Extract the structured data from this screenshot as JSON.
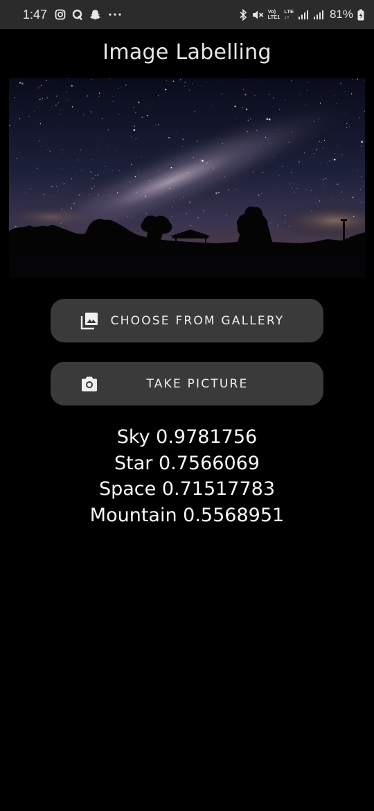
{
  "status_bar": {
    "time": "1:47",
    "volte_top": "Vo)",
    "volte_bottom": "LTE1",
    "lte_top": "LTE",
    "lte_bottom": "↓↑",
    "battery": "81%",
    "left_icons": [
      "instagram-icon",
      "q-app-icon",
      "snapchat-icon",
      "more-dots-icon"
    ],
    "right_icons": [
      "bluetooth-icon",
      "mute-icon",
      "signal-icon",
      "signal-icon",
      "battery-charging-icon"
    ]
  },
  "app_bar": {
    "title": "Image Labelling"
  },
  "preview_image": {
    "subject": "night sky with milky way over silhouetted trees and gazebo"
  },
  "buttons": {
    "gallery": {
      "label": "CHOOSE FROM GALLERY",
      "icon": "photo-library-icon"
    },
    "camera": {
      "label": "TAKE PICTURE",
      "icon": "camera-icon"
    }
  },
  "results": [
    {
      "text": "Sky 0.9781756",
      "label": "Sky",
      "confidence": 0.9781756
    },
    {
      "text": "Star 0.7566069",
      "label": "Star",
      "confidence": 0.7566069
    },
    {
      "text": "Space 0.71517783",
      "label": "Space",
      "confidence": 0.71517783
    },
    {
      "text": "Mountain 0.5568951",
      "label": "Mountain",
      "confidence": 0.5568951
    }
  ],
  "colors": {
    "background": "#000000",
    "status_bar": "#2b2b2b",
    "button": "#3a3a3a",
    "text": "#ffffff"
  }
}
